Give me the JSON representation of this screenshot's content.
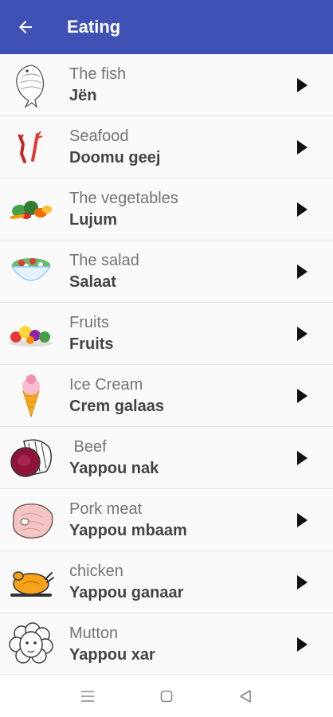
{
  "header": {
    "title": "Eating",
    "back_icon": "arrow-left-icon",
    "background": "#3f51b5"
  },
  "items": [
    {
      "en": "The fish",
      "wo": "Jën",
      "icon": "fish-icon"
    },
    {
      "en": "Seafood",
      "wo": "Doomu geej",
      "icon": "crayfish-icon"
    },
    {
      "en": "The vegetables",
      "wo": "Lujum",
      "icon": "vegetables-icon"
    },
    {
      "en": "The salad",
      "wo": "Salaat",
      "icon": "salad-bowl-icon"
    },
    {
      "en": "Fruits",
      "wo": "Fruits",
      "icon": "fruits-icon"
    },
    {
      "en": "Ice Cream",
      "wo": "Crem galaas",
      "icon": "ice-cream-icon"
    },
    {
      "en": " Beef",
      "wo": "Yappou nak",
      "icon": "beef-icon"
    },
    {
      "en": "Pork meat",
      "wo": "Yappou mbaam",
      "icon": "pork-icon"
    },
    {
      "en": "chicken",
      "wo": "Yappou ganaar",
      "icon": "roast-chicken-icon"
    },
    {
      "en": "Mutton",
      "wo": "Yappou xar",
      "icon": "sheep-icon"
    }
  ],
  "row_action_icon": "play-icon",
  "navbar": {
    "icons": [
      "menu-icon",
      "home-square-icon",
      "back-triangle-icon"
    ]
  }
}
